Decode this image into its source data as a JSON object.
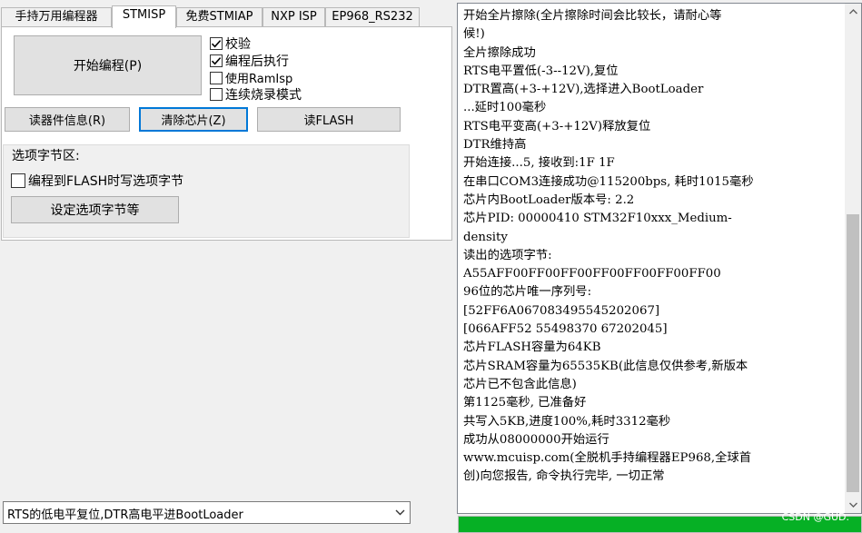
{
  "tabs": [
    {
      "label": "手持万用编程器",
      "active": false
    },
    {
      "label": "STMISP",
      "active": true
    },
    {
      "label": "免费STMIAP",
      "active": false
    },
    {
      "label": "NXP ISP",
      "active": false
    },
    {
      "label": "EP968_RS232",
      "active": false
    }
  ],
  "main": {
    "start_button": "开始编程(P)",
    "options": [
      {
        "label": "校验",
        "checked": true
      },
      {
        "label": "编程后执行",
        "checked": true
      },
      {
        "label": "使用RamIsp",
        "checked": false
      },
      {
        "label": "连续烧录模式",
        "checked": false
      }
    ],
    "read_info_button": "读器件信息(R)",
    "clear_chip_button": "清除芯片(Z)",
    "read_flash_button": "读FLASH"
  },
  "option_bytes": {
    "title": "选项字节区:",
    "checkbox_label": "编程到FLASH时写选项字节",
    "checkbox_checked": false,
    "set_button": "设定选项字节等"
  },
  "dropdown": {
    "selected": "RTS的低电平复位,DTR高电平进BootLoader"
  },
  "log": [
    "开始全片擦除(全片擦除时间会比较长，请耐心等",
    "候!)",
    "全片擦除成功",
    "RTS电平置低(-3--12V),复位",
    "DTR置高(+3-+12V),选择进入BootLoader",
    "...延时100毫秒",
    "RTS电平变高(+3-+12V)释放复位",
    "DTR维持高",
    "开始连接...5, 接收到:1F 1F",
    "在串口COM3连接成功@115200bps, 耗时1015毫秒",
    "芯片内BootLoader版本号: 2.2",
    "芯片PID: 00000410  STM32F10xxx_Medium-",
    "density",
    "读出的选项字节:",
    "A55AFF00FF00FF00FF00FF00FF00FF00",
    "96位的芯片唯一序列号:",
    "[52FF6A067083495545202067]",
    "[066AFF52 55498370 67202045]",
    "芯片FLASH容量为64KB",
    "芯片SRAM容量为65535KB(此信息仅供参考,新版本",
    "芯片已不包含此信息)",
    "第1125毫秒, 已准备好",
    "共写入5KB,进度100%,耗时3312毫秒",
    "成功从08000000开始运行",
    "www.mcuisp.com(全脱机手持编程器EP968,全球首",
    "创)向您报告, 命令执行完毕, 一切正常"
  ],
  "progress": {
    "percent": 100,
    "color": "#06b025"
  },
  "watermark": "CSDN @GUD."
}
